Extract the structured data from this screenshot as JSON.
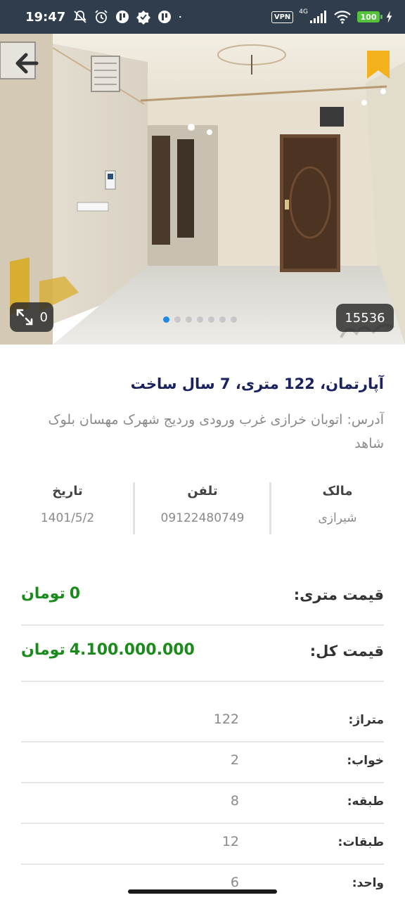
{
  "status_bar": {
    "time": "19:47",
    "vpn_label": "VPN",
    "network_label": "4G",
    "battery_level": "100"
  },
  "hero": {
    "photo_count": "0",
    "listing_id": "15536",
    "pager_total": 7,
    "pager_active_index": 0,
    "icons": {
      "back": "arrow-back-icon",
      "bookmark": "bookmark-icon",
      "expand": "expand-icon"
    },
    "accent_color": "#f3b21b"
  },
  "listing": {
    "title": "آپارتمان، 122 متری، 7 سال ساخت",
    "address": "آدرس: اتوبان خرازی غرب ورودی وردیج شهرک مهسان بلوک شاهد"
  },
  "info": {
    "owner_label": "مالک",
    "owner_value": "شیرازی",
    "phone_label": "تلفن",
    "phone_value": "09122480749",
    "date_label": "تاریخ",
    "date_value": "1401/5/2"
  },
  "prices": {
    "per_meter_label": "قیمت متری:",
    "per_meter_value": "0",
    "total_label": "قیمت کل:",
    "total_value": "4.100.000.000",
    "currency": "تومان",
    "value_color": "#1a8a1a"
  },
  "specs": [
    {
      "label": "متراژ:",
      "value": "122"
    },
    {
      "label": "خواب:",
      "value": "2"
    },
    {
      "label": "طبقه:",
      "value": "8"
    },
    {
      "label": "طبقات:",
      "value": "12"
    },
    {
      "label": "واحد:",
      "value": "6"
    }
  ]
}
